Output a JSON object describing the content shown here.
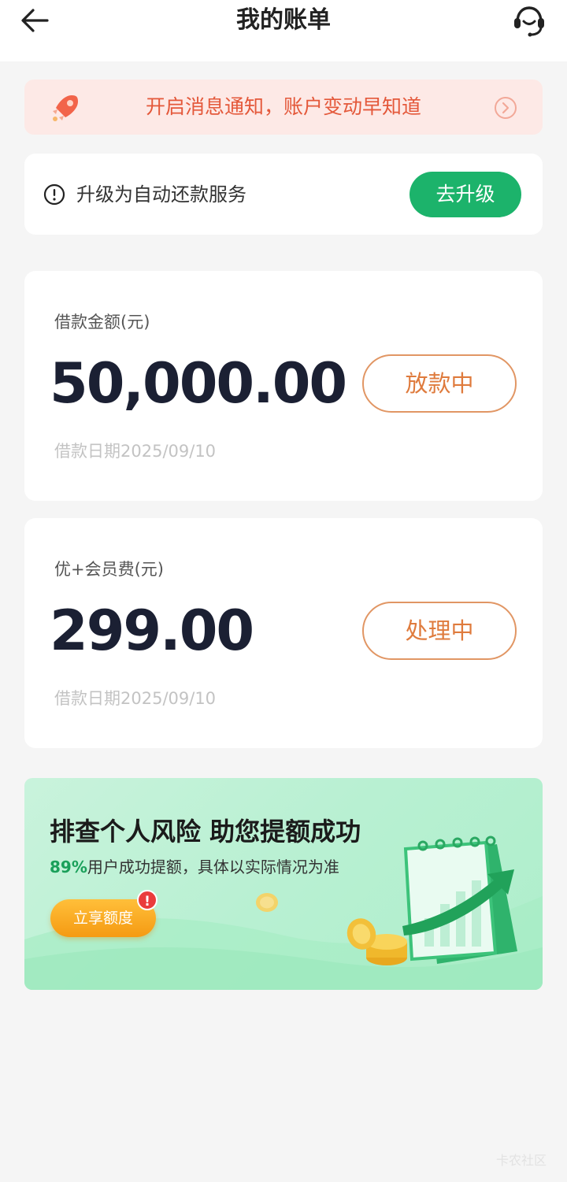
{
  "header": {
    "title": "我的账单",
    "back_icon": "arrow-left-icon",
    "service_icon": "customer-service-icon"
  },
  "notice": {
    "text": "开启消息通知，账户变动早知道",
    "icon": "rocket-icon",
    "arrow_icon": "chevron-right-circle-icon",
    "color": "#e4583a"
  },
  "upgrade": {
    "text": "升级为自动还款服务",
    "button": "去升级",
    "icon": "alert-circle-icon",
    "button_color": "#1cb36b"
  },
  "bills": [
    {
      "label": "借款金额(元)",
      "amount": "50,000.00",
      "status": "放款中",
      "date": "借款日期2025/09/10"
    },
    {
      "label": "优+会员费(元)",
      "amount": "299.00",
      "status": "处理中",
      "date": "借款日期2025/09/10"
    }
  ],
  "promo": {
    "title": "排查个人风险 助您提额成功",
    "percent": "89%",
    "subtitle": "用户成功提额，具体以实际情况为准",
    "button": "立享额度",
    "badge": "!",
    "illustration": "calendar-growth-chart-icon"
  },
  "watermark": "卡农社区"
}
